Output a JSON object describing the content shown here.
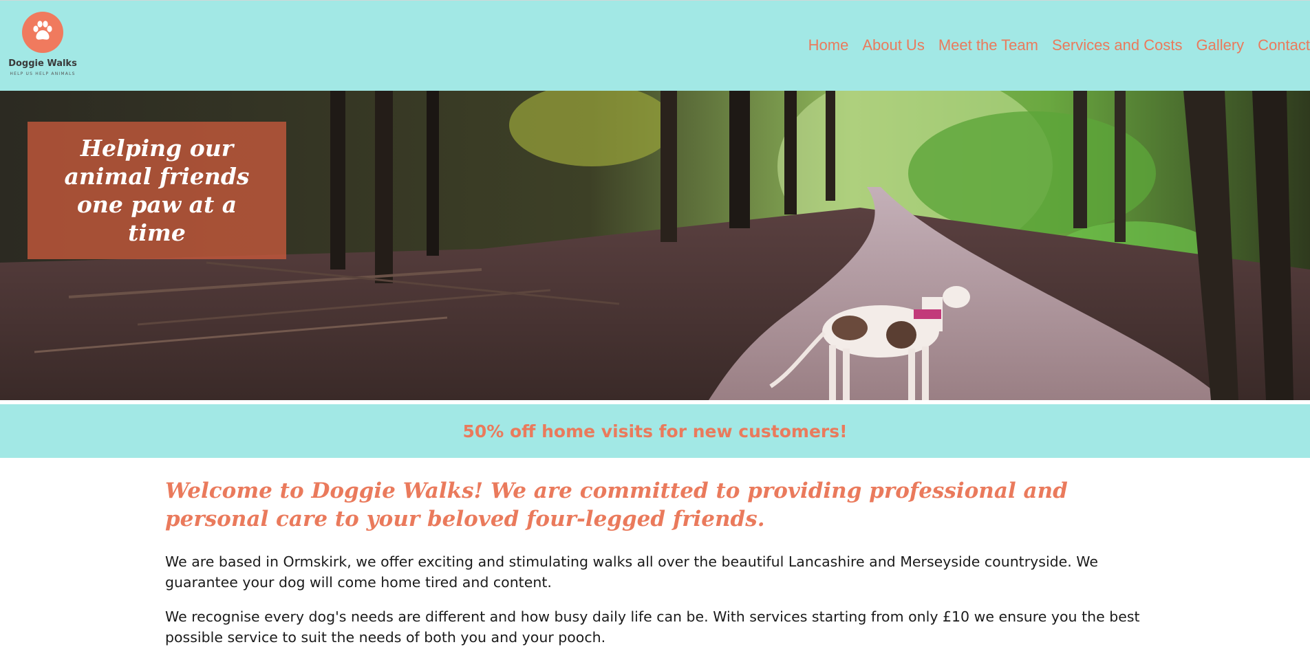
{
  "brand": {
    "name": "Doggie Walks",
    "tagline": "HELP US HELP ANIMALS",
    "logo_icon": "paw-icon",
    "accent_color": "#ea7a5c",
    "header_color": "#a2e8e5"
  },
  "nav": {
    "items": [
      {
        "label": "Home"
      },
      {
        "label": "About Us"
      },
      {
        "label": "Meet the Team"
      },
      {
        "label": "Services and Costs"
      },
      {
        "label": "Gallery"
      },
      {
        "label": "Contact"
      }
    ]
  },
  "hero": {
    "headline": "Helping our animal friends one paw at a time"
  },
  "promo": {
    "text": "50% off home visits for new customers!"
  },
  "main": {
    "welcome": "Welcome to Doggie Walks! We are committed to providing professional and personal care to your beloved four-legged friends.",
    "paragraphs": [
      "We are based in Ormskirk, we offer exciting and stimulating walks all over the beautiful Lancashire and Merseyside countryside. We guarantee your dog will come home tired and content.",
      "We recognise every dog's needs are different and how busy daily life can be. With services starting from only £10 we ensure you the best possible service to suit the needs of both you and your pooch."
    ]
  }
}
